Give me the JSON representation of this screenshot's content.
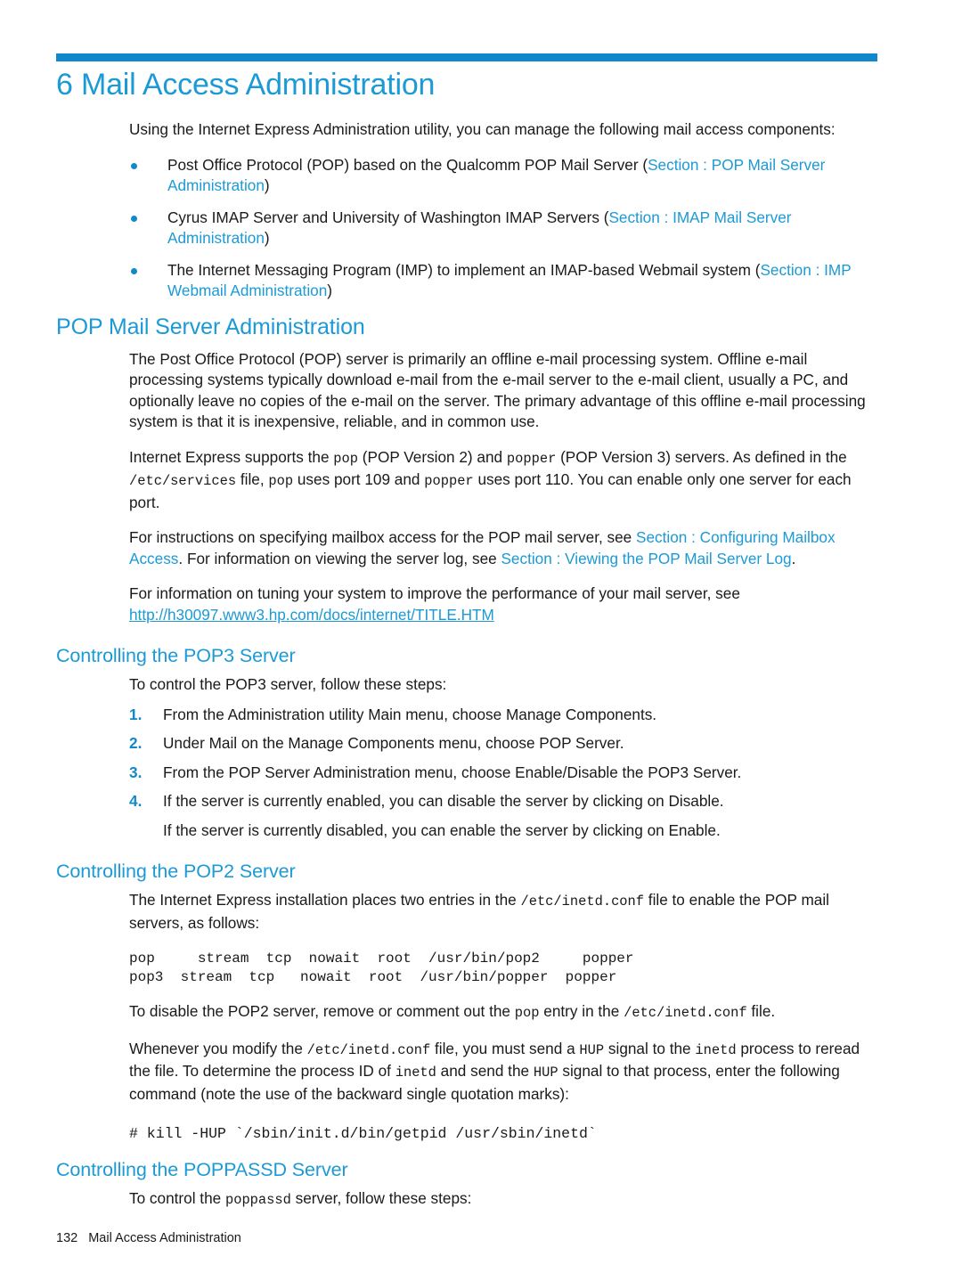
{
  "chapter": {
    "number": "6",
    "title": "6 Mail Access Administration"
  },
  "intro": {
    "paragraph": "Using the Internet Express Administration utility, you can manage the following mail access components:"
  },
  "bullets": [
    {
      "text_before": "Post Office Protocol (POP) based on the Qualcomm POP Mail Server (",
      "link": "Section : POP Mail Server Administration",
      "text_after": ")"
    },
    {
      "text_before": "Cyrus IMAP Server and University of Washington IMAP Servers (",
      "link": "Section : IMAP Mail Server Administration",
      "text_after": ")"
    },
    {
      "text_before": "The Internet Messaging Program (IMP) to implement an IMAP-based Webmail system (",
      "link": "Section : IMP Webmail Administration",
      "text_after": ")"
    }
  ],
  "pop_section": {
    "heading": "POP Mail Server Administration",
    "para1": "The Post Office Protocol (POP) server is primarily an offline e-mail processing system. Offline e-mail processing systems typically download e-mail from the e-mail server to the e-mail client, usually a PC, and optionally leave no copies of the e-mail on the server. The primary advantage of this offline e-mail processing system is that it is inexpensive, reliable, and in common use.",
    "para2": {
      "s1": "Internet Express supports the ",
      "c1": "pop",
      "s2": " (POP Version 2) and ",
      "c2": "popper",
      "s3": " (POP Version 3) servers. As defined in the ",
      "c3": "/etc/services",
      "s4": " file, ",
      "c4": "pop",
      "s5": " uses port 109 and ",
      "c5": "popper",
      "s6": " uses port 110. You can enable only one server for each port."
    },
    "para3": {
      "s1": "For instructions on specifying mailbox access for the POP mail server, see ",
      "link1": "Section : Configuring Mailbox Access",
      "s2": ". For information on viewing the server log, see ",
      "link2": "Section : Viewing the POP Mail Server Log",
      "s3": "."
    },
    "para4": {
      "s1": "For information on tuning your system to improve the performance of your mail server, see ",
      "url": "http://h30097.www3.hp.com/docs/internet/TITLE.HTM"
    }
  },
  "pop3_section": {
    "heading": "Controlling the POP3 Server",
    "intro": "To control the POP3 server, follow these steps:",
    "steps": [
      "From the Administration utility Main menu, choose Manage Components.",
      "Under Mail on the Manage Components menu, choose POP Server.",
      "From the POP Server Administration menu, choose Enable/Disable the POP3 Server.",
      "If the server is currently enabled, you can disable the server by clicking on Disable."
    ],
    "substep": "If the server is currently disabled, you can enable the server by clicking on Enable."
  },
  "pop2_section": {
    "heading": "Controlling the POP2 Server",
    "para1": {
      "s1": "The Internet Express installation places two entries in the ",
      "c1": "/etc/inetd.conf",
      "s2": " file to enable the POP mail servers, as follows:"
    },
    "code_block": "pop     stream  tcp  nowait  root  /usr/bin/pop2     popper\npop3  stream  tcp   nowait  root  /usr/bin/popper  popper",
    "para2": {
      "s1": "To disable the POP2 server, remove or comment out the ",
      "c1": "pop",
      "s2": " entry in the ",
      "c2": "/etc/inetd.conf",
      "s3": " file."
    },
    "para3": {
      "s1": "Whenever you modify the ",
      "c1": "/etc/inetd.conf",
      "s2": " file, you must send a ",
      "c2": "HUP",
      "s3": " signal to the ",
      "c3": "inetd",
      "s4": " process to reread the file. To determine the process ID of ",
      "c4": "inetd",
      "s5": " and send the ",
      "c5": "HUP",
      "s6": " signal to that process, enter the following command (note the use of the backward single quotation marks):"
    },
    "command": "# kill -HUP `/sbin/init.d/bin/getpid /usr/sbin/inetd`"
  },
  "poppassd_section": {
    "heading": "Controlling the POPPASSD Server",
    "para1": {
      "s1": "To control the ",
      "c1": "poppassd",
      "s2": " server, follow these steps:"
    }
  },
  "footer": {
    "page_number": "132",
    "running_head": "Mail Access Administration"
  },
  "colors": {
    "accent_blue": "#1b9ad6",
    "rule_blue": "#1188ca",
    "body_text": "#1a1a1a"
  }
}
